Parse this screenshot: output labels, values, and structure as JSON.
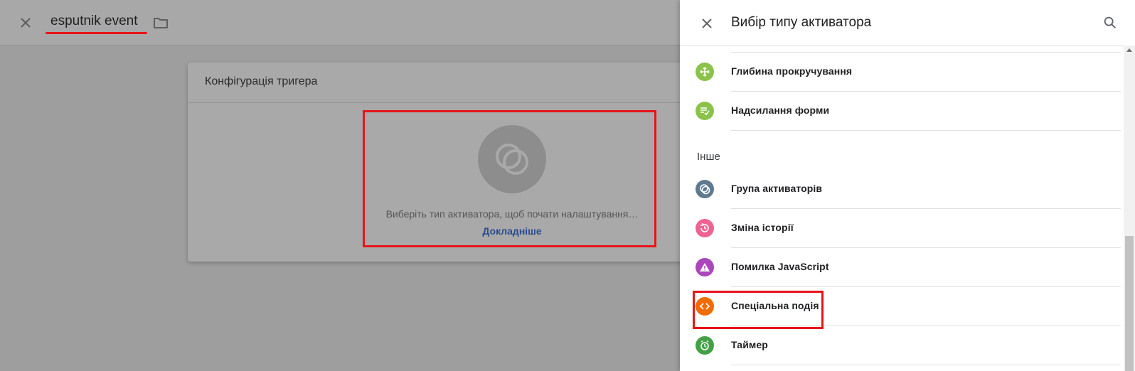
{
  "editor": {
    "title": "esputnik event",
    "card_title": "Конфігурація тригера",
    "placeholder_text": "Виберіть тип активатора, щоб почати налаштування…",
    "learn_more": "Докладніше"
  },
  "panel": {
    "title": "Вибір типу активатора",
    "items_top": [
      {
        "label": "Глибина прокручування",
        "icon": "scroll-depth-icon",
        "color": "#8bc34a"
      },
      {
        "label": "Надсилання форми",
        "icon": "form-submit-icon",
        "color": "#8bc34a"
      }
    ],
    "section_other": "Інше",
    "items_other": [
      {
        "label": "Група активаторів",
        "icon": "trigger-group-icon",
        "color": "#5f7a8f"
      },
      {
        "label": "Зміна історії",
        "icon": "history-change-icon",
        "color": "#f06292"
      },
      {
        "label": "Помилка JavaScript",
        "icon": "js-error-icon",
        "color": "#ab47bc"
      },
      {
        "label": "Спеціальна подія",
        "icon": "custom-event-icon",
        "color": "#ef6c00"
      },
      {
        "label": "Таймер",
        "icon": "timer-icon",
        "color": "#43a047"
      }
    ]
  },
  "colors": {
    "highlight": "#e8141a",
    "link": "#2b4b8f"
  }
}
